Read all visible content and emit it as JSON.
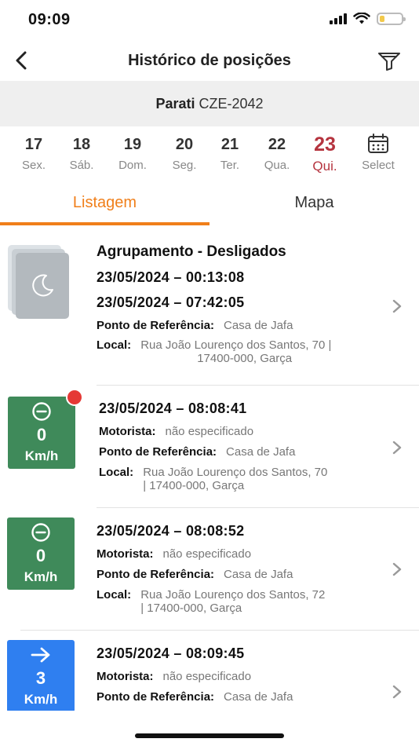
{
  "status_bar": {
    "time": "09:09",
    "battery_color": "#f2c94c"
  },
  "nav": {
    "title": "Histórico de posições",
    "back_icon": "chevron-left-icon",
    "filter_icon": "filter-icon"
  },
  "vehicle": {
    "name": "Parati",
    "plate": "CZE-2042"
  },
  "dates": [
    {
      "num": "17",
      "name": "Sex."
    },
    {
      "num": "18",
      "name": "Sáb."
    },
    {
      "num": "19",
      "name": "Dom."
    },
    {
      "num": "20",
      "name": "Seg."
    },
    {
      "num": "21",
      "name": "Ter."
    },
    {
      "num": "22",
      "name": "Qua."
    },
    {
      "num": "23",
      "name": "Qui.",
      "selected": true
    }
  ],
  "calendar_select": "Select",
  "tabs": {
    "list": "Listagem",
    "map": "Mapa",
    "active": "Listagem"
  },
  "colors": {
    "accent": "#f07f1a",
    "selected_day": "#b5343f",
    "stopped": "#3f8a5a",
    "moving": "#2f7ff0",
    "alert": "#e53935"
  },
  "labels": {
    "reference": "Ponto de Referência:",
    "local": "Local:",
    "driver": "Motorista:"
  },
  "items": [
    {
      "title": "Agrupamento - Desligados",
      "start": "23/05/2024  –  00:13:08",
      "end": "23/05/2024  –  07:42:05",
      "reference": "Casa de Jafa",
      "local_line1": "Rua João Lourenço dos Santos, 70  |",
      "local_line2": "17400-000, Garça",
      "icon": "moon-icon"
    },
    {
      "datetime": "23/05/2024  –  08:08:41",
      "driver": "não especificado",
      "reference": "Casa de Jafa",
      "local_line1": "Rua João Lourenço dos Santos, 70",
      "local_line2": "|  17400-000, Garça",
      "speed": "0",
      "unit": "Km/h",
      "icon": "stopped-icon",
      "alert": true
    },
    {
      "datetime": "23/05/2024  –  08:08:52",
      "driver": "não especificado",
      "reference": "Casa de Jafa",
      "local_line1": "Rua João Lourenço dos Santos, 72",
      "local_line2": "|  17400-000, Garça",
      "speed": "0",
      "unit": "Km/h",
      "icon": "stopped-icon"
    },
    {
      "datetime": "23/05/2024  –  08:09:45",
      "driver": "não especificado",
      "reference": "Casa de Jafa",
      "speed": "3",
      "unit": "Km/h",
      "icon": "arrow-right-icon"
    }
  ]
}
